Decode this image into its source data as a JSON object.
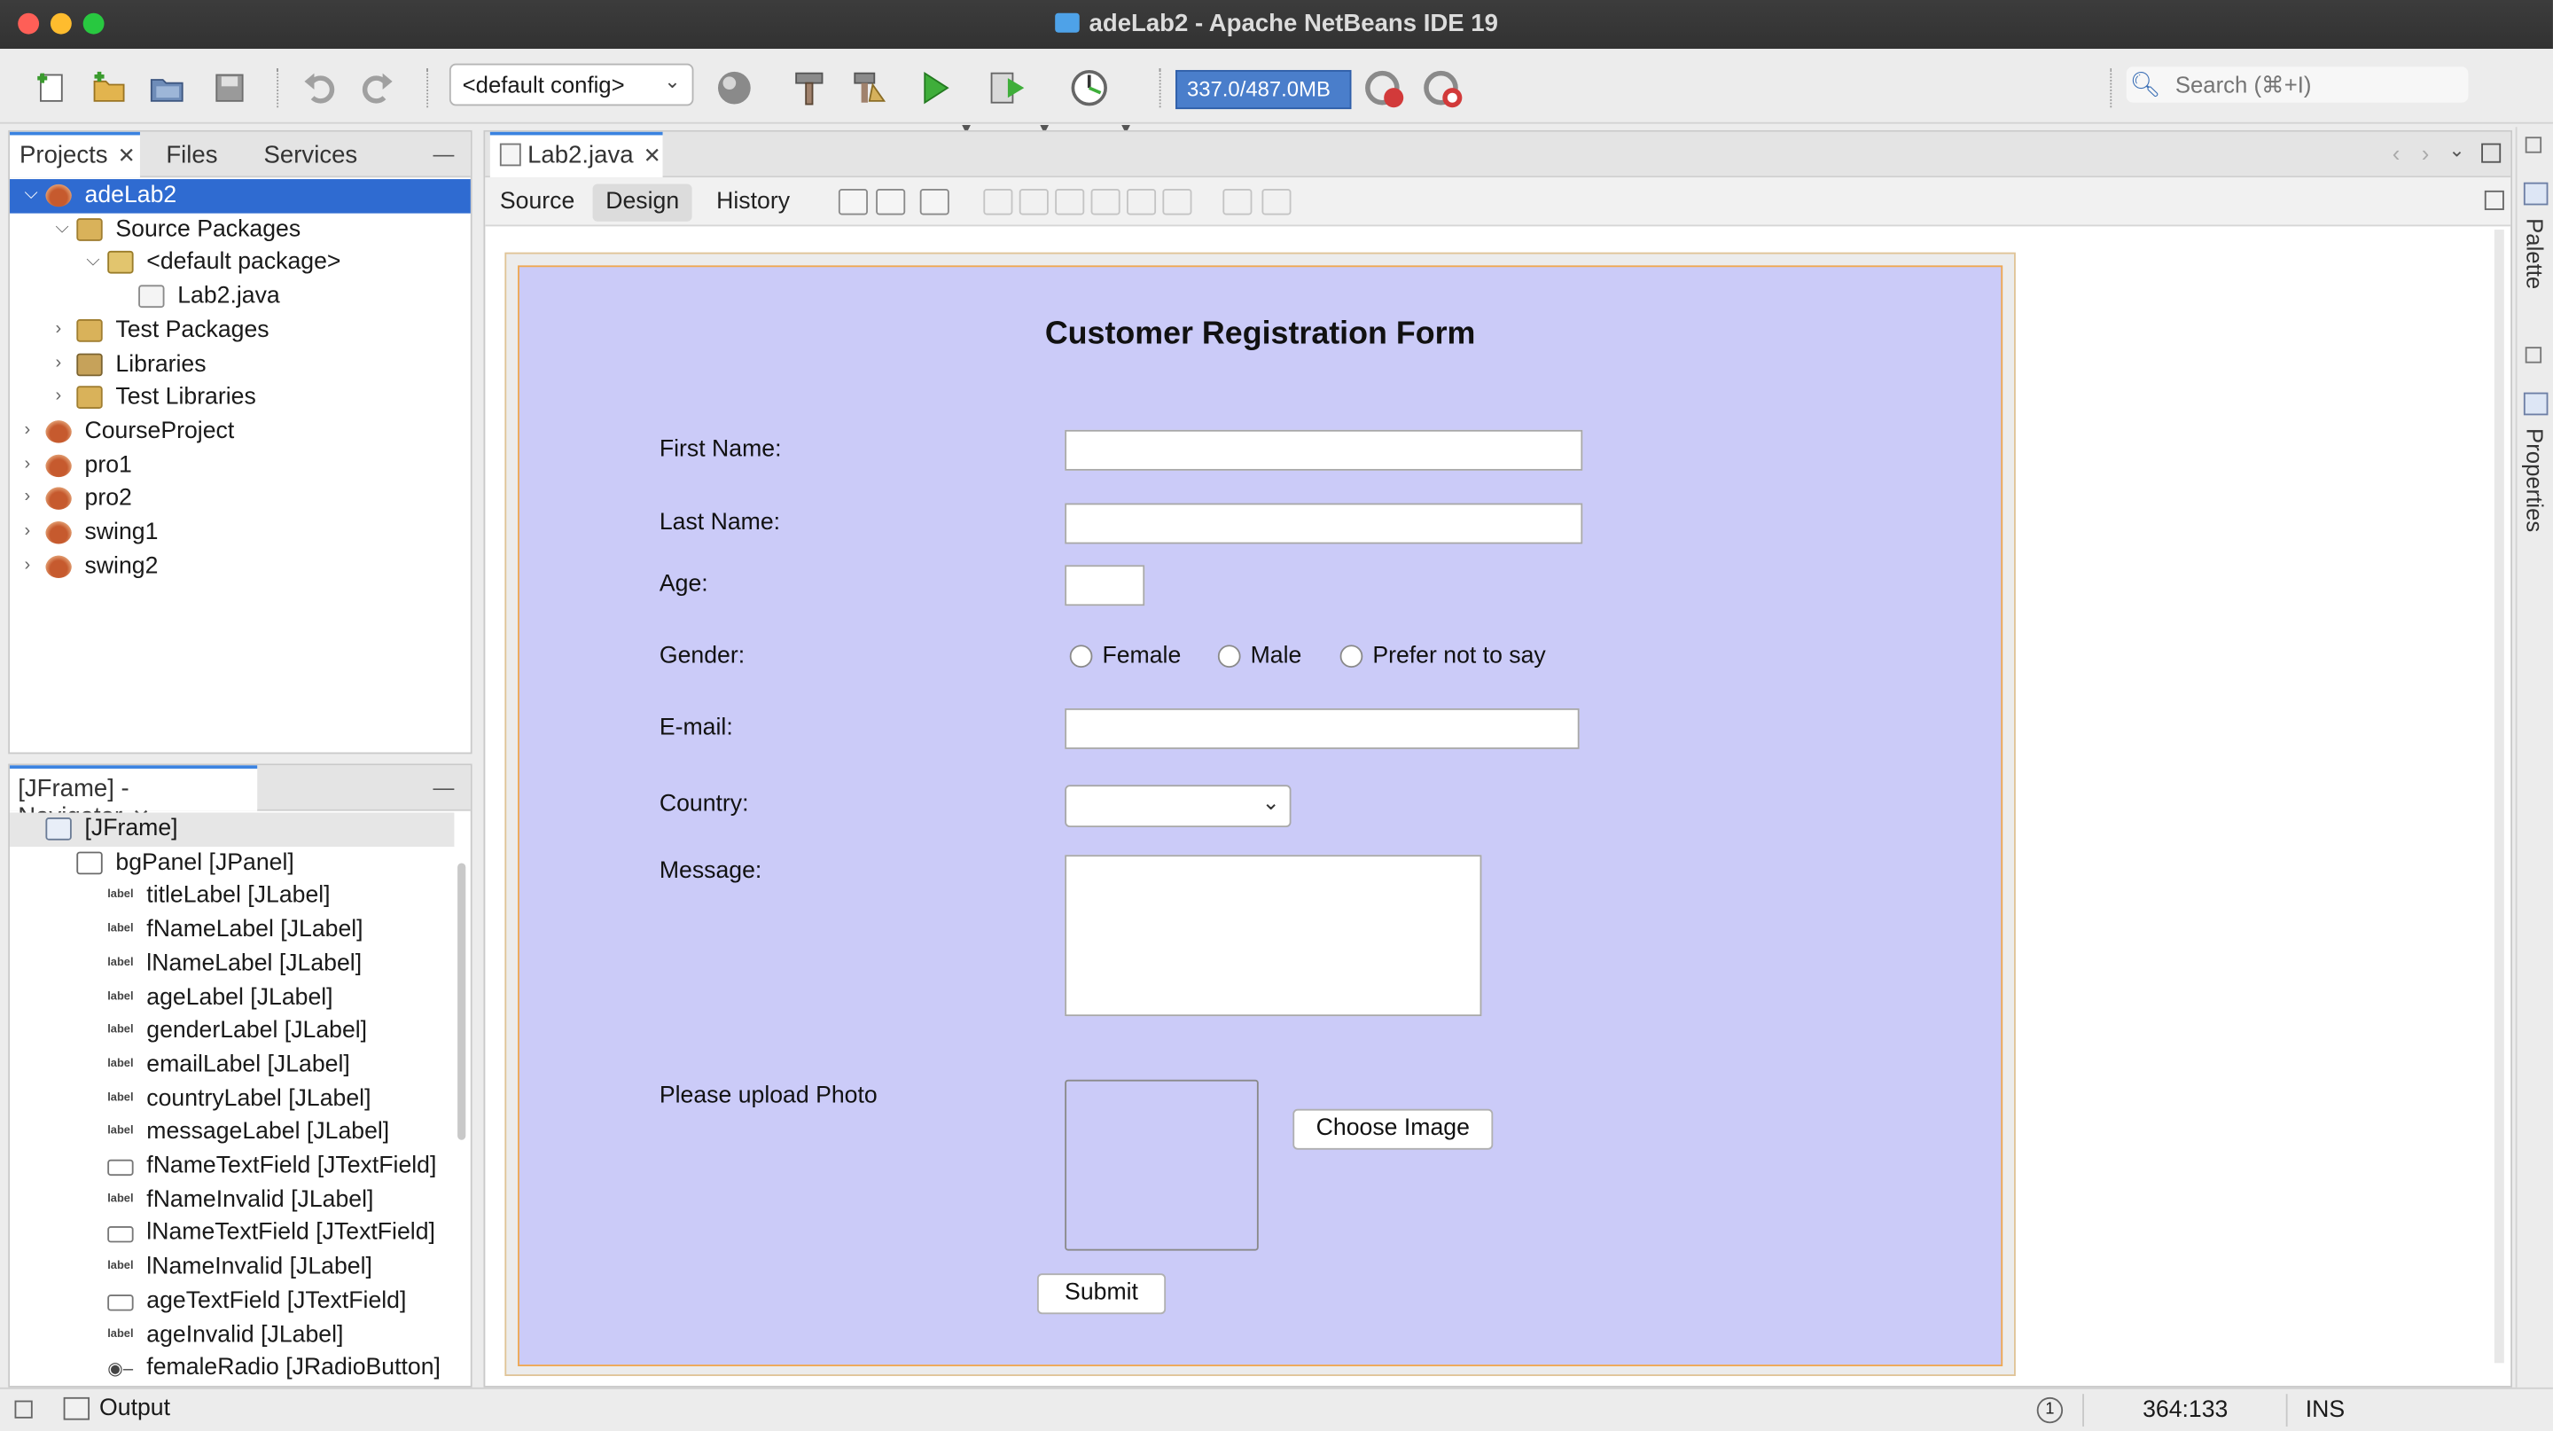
{
  "window": {
    "title": "adeLab2 - Apache NetBeans IDE 19",
    "traffic_lights": {
      "close": "#fe5f57",
      "minimize": "#febc2e",
      "zoom": "#28c840"
    }
  },
  "toolbar": {
    "config_value": "<default config>",
    "memory_label": "337.0/487.0MB",
    "search_placeholder": "Search (⌘+I)"
  },
  "projects_panel": {
    "tabs": [
      "Projects",
      "Files",
      "Services"
    ],
    "active_tab": "Projects",
    "tree": [
      {
        "label": "adeLab2",
        "depth": 0,
        "icon": "project-cup-icon",
        "expanded": true,
        "selected": true
      },
      {
        "label": "Source Packages",
        "depth": 1,
        "icon": "package-folder-icon",
        "expanded": true
      },
      {
        "label": "<default package>",
        "depth": 2,
        "icon": "package-icon",
        "expanded": true
      },
      {
        "label": "Lab2.java",
        "depth": 3,
        "icon": "java-form-file-icon"
      },
      {
        "label": "Test Packages",
        "depth": 1,
        "icon": "package-folder-icon",
        "expanded": false
      },
      {
        "label": "Libraries",
        "depth": 1,
        "icon": "libraries-icon",
        "expanded": false
      },
      {
        "label": "Test Libraries",
        "depth": 1,
        "icon": "package-folder-icon",
        "expanded": false
      },
      {
        "label": "CourseProject",
        "depth": 0,
        "icon": "project-cup-icon",
        "expanded": false
      },
      {
        "label": "pro1",
        "depth": 0,
        "icon": "project-cup-icon",
        "expanded": false
      },
      {
        "label": "pro2",
        "depth": 0,
        "icon": "project-cup-icon",
        "expanded": false
      },
      {
        "label": "swing1",
        "depth": 0,
        "icon": "project-cup-icon",
        "expanded": false
      },
      {
        "label": "swing2",
        "depth": 0,
        "icon": "project-cup-icon",
        "expanded": false
      }
    ]
  },
  "navigator_panel": {
    "title": "[JFrame] - Navigator",
    "items": [
      {
        "label": "[JFrame]",
        "icon": "jframe-icon",
        "depth": 0
      },
      {
        "label": "bgPanel [JPanel]",
        "icon": "jpanel-icon",
        "depth": 1
      },
      {
        "label": "titleLabel [JLabel]",
        "icon": "jlabel-icon",
        "depth": 2
      },
      {
        "label": "fNameLabel [JLabel]",
        "icon": "jlabel-icon",
        "depth": 2
      },
      {
        "label": "lNameLabel [JLabel]",
        "icon": "jlabel-icon",
        "depth": 2
      },
      {
        "label": "ageLabel [JLabel]",
        "icon": "jlabel-icon",
        "depth": 2
      },
      {
        "label": "genderLabel [JLabel]",
        "icon": "jlabel-icon",
        "depth": 2
      },
      {
        "label": "emailLabel [JLabel]",
        "icon": "jlabel-icon",
        "depth": 2
      },
      {
        "label": "countryLabel [JLabel]",
        "icon": "jlabel-icon",
        "depth": 2
      },
      {
        "label": "messageLabel [JLabel]",
        "icon": "jlabel-icon",
        "depth": 2
      },
      {
        "label": "fNameTextField [JTextField]",
        "icon": "jtextfield-icon",
        "depth": 2
      },
      {
        "label": "fNameInvalid [JLabel]",
        "icon": "jlabel-icon",
        "depth": 2
      },
      {
        "label": "lNameTextField [JTextField]",
        "icon": "jtextfield-icon",
        "depth": 2
      },
      {
        "label": "lNameInvalid [JLabel]",
        "icon": "jlabel-icon",
        "depth": 2
      },
      {
        "label": "ageTextField [JTextField]",
        "icon": "jtextfield-icon",
        "depth": 2
      },
      {
        "label": "ageInvalid [JLabel]",
        "icon": "jlabel-icon",
        "depth": 2
      },
      {
        "label": "femaleRadio [JRadioButton]",
        "icon": "jradiobutton-icon",
        "depth": 2
      }
    ]
  },
  "editor": {
    "file_tab": "Lab2.java",
    "view_tabs": [
      "Source",
      "Design",
      "History"
    ],
    "active_view": "Design"
  },
  "form": {
    "title": "Customer Registration Form",
    "first_name_label": "First Name:",
    "last_name_label": "Last Name:",
    "age_label": "Age:",
    "gender_label": "Gender:",
    "gender_options": [
      "Female",
      "Male",
      "Prefer not to say"
    ],
    "email_label": "E-mail:",
    "country_label": "Country:",
    "message_label": "Message:",
    "photo_label": "Please upload Photo",
    "choose_image_button": "Choose Image",
    "submit_button": "Submit",
    "background_color": "#cbcbf8"
  },
  "right_rail": {
    "palette": "Palette",
    "properties": "Properties"
  },
  "statusbar": {
    "output_label": "Output",
    "cursor_position": "364:133",
    "insert_mode": "INS"
  }
}
